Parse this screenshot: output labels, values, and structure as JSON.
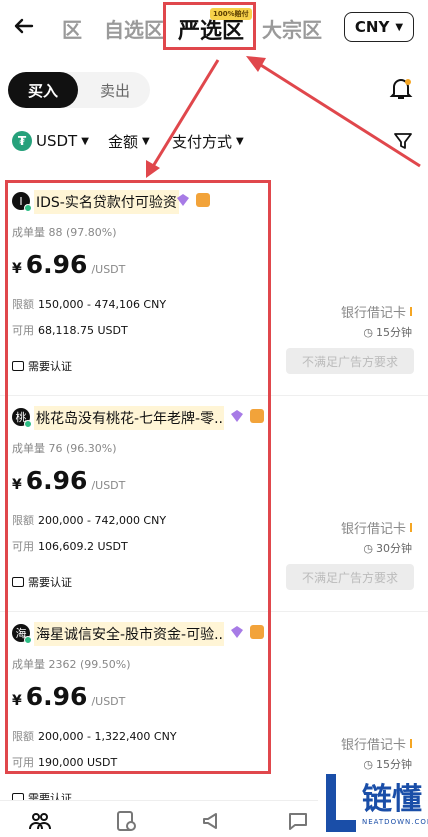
{
  "header": {
    "back_icon": "arrow-left-icon",
    "tabs": [
      {
        "label": "区",
        "active": false
      },
      {
        "label": "自选区",
        "active": false
      },
      {
        "label": "严选区",
        "active": true
      },
      {
        "label": "大宗区",
        "active": false
      }
    ],
    "active_badge": "100%赔付",
    "currency": "CNY"
  },
  "trade_toggle": {
    "buy": "买入",
    "sell": "卖出"
  },
  "filters": {
    "asset": "USDT",
    "amount": "金额",
    "payment": "支付方式"
  },
  "ads": [
    {
      "avatar": "I",
      "name": "IDS-实名贷款付可验资",
      "stat_label": "成单量",
      "stat_value": "88 (97.80%)",
      "currency_symbol": "¥",
      "price": "6.96",
      "price_unit": "/USDT",
      "limit_label": "限额",
      "limit": "150,000 - 474,106 CNY",
      "avail_label": "可用",
      "available": "68,118.75 USDT",
      "verify": "需要认证",
      "payment": "银行借记卡",
      "time": "15分钟",
      "button": "不满足广告方要求"
    },
    {
      "avatar": "桃",
      "name": "桃花岛没有桃花-七年老牌-零...",
      "stat_label": "成单量",
      "stat_value": "76 (96.30%)",
      "currency_symbol": "¥",
      "price": "6.96",
      "price_unit": "/USDT",
      "limit_label": "限额",
      "limit": "200,000 - 742,000 CNY",
      "avail_label": "可用",
      "available": "106,609.2 USDT",
      "verify": "需要认证",
      "payment": "银行借记卡",
      "time": "30分钟",
      "button": "不满足广告方要求"
    },
    {
      "avatar": "海",
      "name": "海星诚信安全-股市资金-可验...",
      "stat_label": "成单量",
      "stat_value": "2362 (99.50%)",
      "currency_symbol": "¥",
      "price": "6.96",
      "price_unit": "/USDT",
      "limit_label": "限额",
      "limit": "200,000 - 1,322,400 CNY",
      "avail_label": "可用",
      "available": "190,000 USDT",
      "verify": "需要认证",
      "payment": "银行借记卡",
      "time": "15分钟",
      "button": ""
    }
  ],
  "watermark": {
    "text": "链懂",
    "sub": "NEATDOWN.COM"
  },
  "colors": {
    "annotation": "#e0474c",
    "accent": "#f5a623",
    "online": "#2ebd85"
  }
}
